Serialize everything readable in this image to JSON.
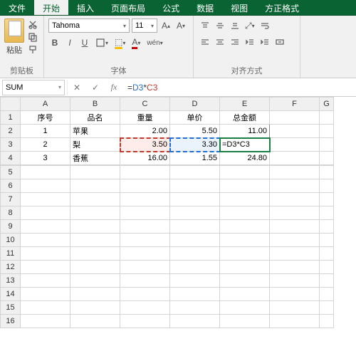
{
  "tabs": {
    "file": "文件",
    "home": "开始",
    "insert": "插入",
    "layout": "页面布局",
    "formula": "公式",
    "data": "数据",
    "view": "视图",
    "addin": "方正格式"
  },
  "ribbon": {
    "clip": {
      "paste": "粘贴",
      "label": "剪贴板"
    },
    "font": {
      "name": "Tahoma",
      "size": "11",
      "bold": "B",
      "italic": "I",
      "underline": "U",
      "label": "字体"
    },
    "align": {
      "label": "对齐方式"
    }
  },
  "fbar": {
    "name": "SUM",
    "formula_eq": "=",
    "formula_d3": "D3",
    "formula_star": "*",
    "formula_c3": "C3"
  },
  "cols": [
    "A",
    "B",
    "C",
    "D",
    "E",
    "F",
    "G"
  ],
  "headers": {
    "A": "序号",
    "B": "品名",
    "C": "重量",
    "D": "单价",
    "E": "总金额"
  },
  "rows": [
    {
      "n": "1",
      "A": "1",
      "B": "苹果",
      "C": "2.00",
      "D": "5.50",
      "E": "11.00"
    },
    {
      "n": "2",
      "A": "2",
      "B": "梨",
      "C": "3.50",
      "D": "3.30",
      "E": "=D3*C3"
    },
    {
      "n": "3",
      "A": "3",
      "B": "香蕉",
      "C": "16.00",
      "D": "1.55",
      "E": "24.80"
    }
  ],
  "chart_data": {
    "type": "table",
    "columns": [
      "序号",
      "品名",
      "重量",
      "单价",
      "总金额"
    ],
    "data": [
      [
        1,
        "苹果",
        2.0,
        5.5,
        11.0
      ],
      [
        2,
        "梨",
        3.5,
        3.3,
        null
      ],
      [
        3,
        "香蕉",
        16.0,
        1.55,
        24.8
      ]
    ],
    "editing_cell": "E3",
    "editing_formula": "=D3*C3"
  }
}
